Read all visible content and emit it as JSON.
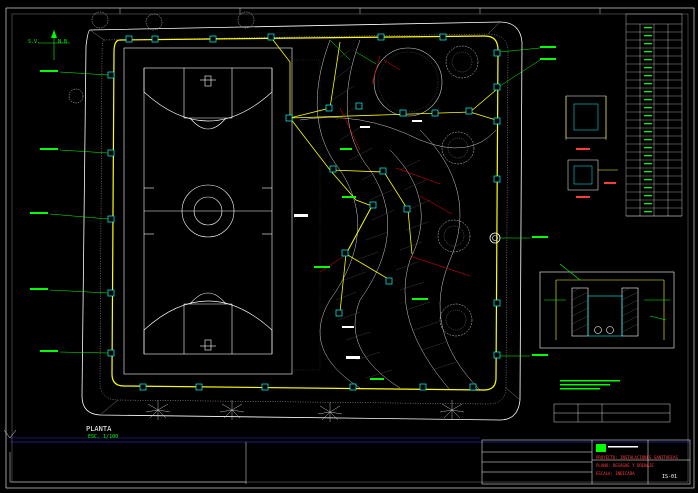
{
  "drawing": {
    "plan_title": "PLANTA",
    "plan_scale": "ESC. 1/100",
    "sheet_code": "IS-01"
  },
  "compass": {
    "west_label": "S.V.",
    "east_label": "N.B"
  },
  "title_block": {
    "line1": "PROYECTO: INSTALACIONES SANITARIAS",
    "line2": "PLANO: DESAGUE Y DRENAJE",
    "line3": "ESCALA: INDICADA"
  },
  "colors": {
    "background": "#000000",
    "boundary": "#ffffff",
    "pipe": "#ffff00",
    "accent_green": "#00ff00",
    "accent_cyan": "#00ffff",
    "accent_red": "#ff0000",
    "accent_blue": "#3b3bff"
  },
  "icons": [
    "north-arrow-icon",
    "tree-icon",
    "manhole-icon",
    "palm-icon"
  ]
}
